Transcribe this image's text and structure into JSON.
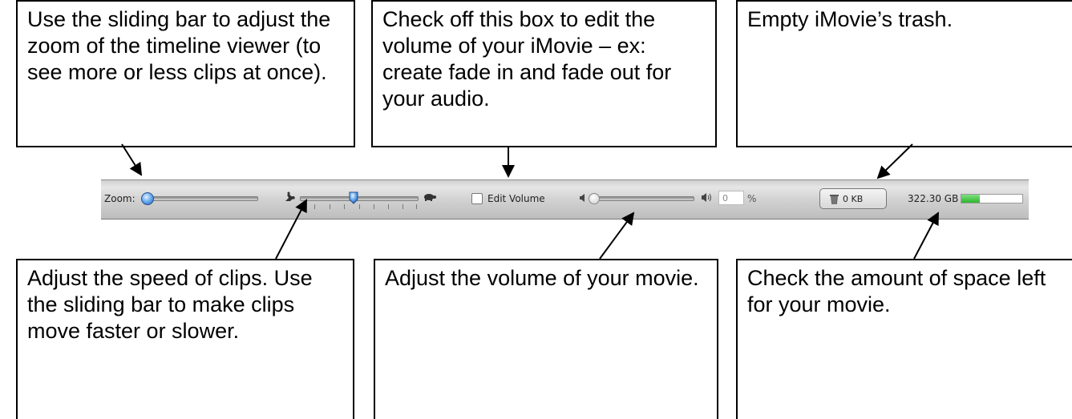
{
  "callouts": {
    "zoom": "Use the sliding bar to adjust the zoom of the timeline viewer (to see more or less clips at once).",
    "edit_volume": "Check off this box to edit the volume of your iMovie – ex: create fade in and fade out for your audio.",
    "trash": "Empty iMovie’s trash.",
    "speed": "Adjust the speed of clips. Use the sliding bar to make clips move faster or slower.",
    "volume": "Adjust the volume of your movie.",
    "space": "Check the amount of space left for your movie."
  },
  "toolbar": {
    "zoom_label": "Zoom:",
    "zoom_level": 0.0,
    "speed_level": 0.45,
    "edit_volume_label": "Edit Volume",
    "edit_volume_checked": false,
    "volume_level": 0.0,
    "volume_value": "0",
    "volume_unit": "%",
    "trash_label": "0 KB",
    "space_label": "322.30 GB",
    "space_fill_fraction": 0.3,
    "space_fill_color": "#2fb52f",
    "icons": {
      "speed_fast": "rabbit-icon",
      "speed_slow": "turtle-icon",
      "volume_low": "speaker-low-icon",
      "volume_high": "speaker-high-icon",
      "trash": "trash-icon"
    }
  }
}
